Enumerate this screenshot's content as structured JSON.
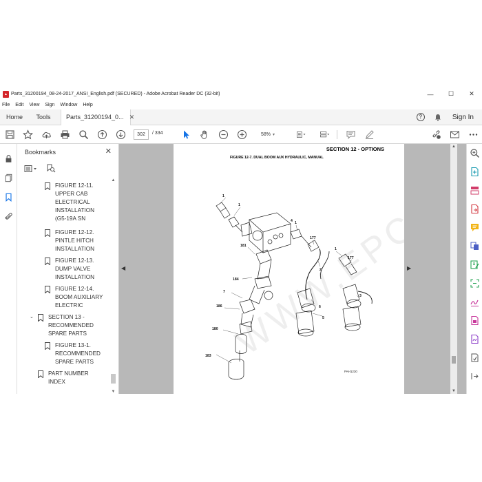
{
  "window": {
    "title": "Parts_31200194_08-24-2017_ANSI_English.pdf (SECURED) - Adobe Acrobat Reader DC (32-bit)",
    "minimize": "—",
    "maximize": "☐",
    "close": "✕"
  },
  "menu": [
    "File",
    "Edit",
    "View",
    "Sign",
    "Window",
    "Help"
  ],
  "tabs": {
    "home": "Home",
    "tools": "Tools",
    "document": "Parts_31200194_0...",
    "sign_in": "Sign In"
  },
  "toolbar": {
    "current_page": "302",
    "total_pages": "/ 334",
    "zoom": "58%"
  },
  "bookmarks": {
    "title": "Bookmarks",
    "items": [
      {
        "label": "FIGURE 12-11.\nUPPER CAB\nELECTRICAL\nINSTALLATION\n(G5-19A SN",
        "level": 2
      },
      {
        "label": "FIGURE 12-12.\nPINTLE HITCH\nINSTALLATION",
        "level": 2
      },
      {
        "label": "FIGURE 12-13.\nDUMP VALVE\nINSTALLATION",
        "level": 2
      },
      {
        "label": "FIGURE 12-14.\nBOOM AUXILIARY\nELECTRIC",
        "level": 2
      },
      {
        "label": "SECTION 13 -\nRECOMMENDED\nSPARE PARTS",
        "level": 1,
        "expanded": true
      },
      {
        "label": "FIGURE 13-1.\nRECOMMENDED\nSPARE PARTS",
        "level": 2
      },
      {
        "label": "PART NUMBER\nINDEX",
        "level": 1
      }
    ]
  },
  "page": {
    "section_title": "SECTION 12 - OPTIONS",
    "figure_title": "FIGURE 12-7. DUAL BOOM AUX HYDRAULIC, MANUAL",
    "figure_code": "PAH1230",
    "callouts": [
      "1",
      "1",
      "4",
      "1",
      "177",
      "1",
      "181",
      "184",
      "7",
      "2",
      "177",
      "186",
      "3",
      "6",
      "180",
      "5",
      "183"
    ],
    "watermark": "WWW.EPCEPO.COM"
  },
  "colors": {
    "accent": "#1473e6",
    "doc_background": "#b8b8b8",
    "pdf_red": "#d4262b"
  }
}
